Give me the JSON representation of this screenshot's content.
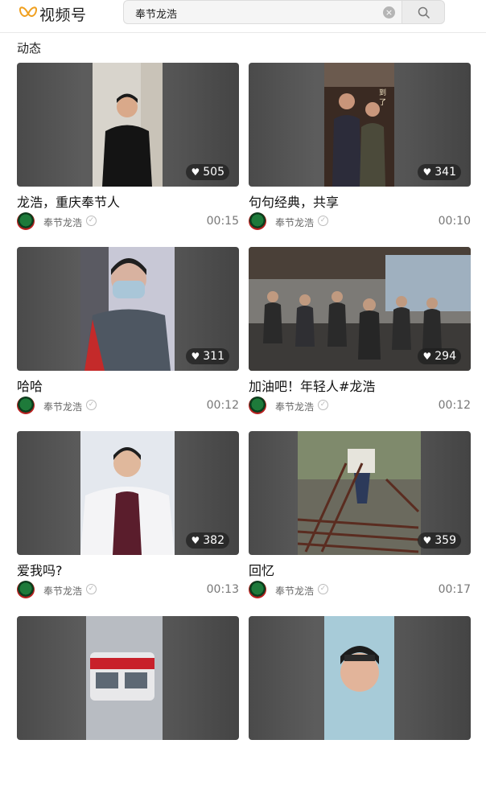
{
  "header": {
    "logo_text": "视频号",
    "search_value": "奉节龙浩",
    "clear_icon": "clear-icon",
    "search_icon": "search-icon"
  },
  "section": {
    "title": "动态"
  },
  "colors": {
    "accent": "#f0a020",
    "like_badge": "#1e1e1e",
    "muted": "#777777"
  },
  "cards": [
    {
      "likes": "505",
      "title": "龙浩，重庆奉节人",
      "author": "奉节龙浩",
      "duration": "00:15"
    },
    {
      "likes": "341",
      "title": "句句经典，共享",
      "author": "奉节龙浩",
      "duration": "00:10"
    },
    {
      "likes": "311",
      "title": "哈哈",
      "author": "奉节龙浩",
      "duration": "00:12"
    },
    {
      "likes": "294",
      "title": "加油吧！年轻人#龙浩",
      "author": "奉节龙浩",
      "duration": "00:12"
    },
    {
      "likes": "382",
      "title": "爱我吗?",
      "author": "奉节龙浩",
      "duration": "00:13"
    },
    {
      "likes": "359",
      "title": "回忆",
      "author": "奉节龙浩",
      "duration": "00:17"
    },
    {
      "likes": "",
      "title": "",
      "author": "",
      "duration": ""
    },
    {
      "likes": "",
      "title": "",
      "author": "",
      "duration": ""
    }
  ]
}
